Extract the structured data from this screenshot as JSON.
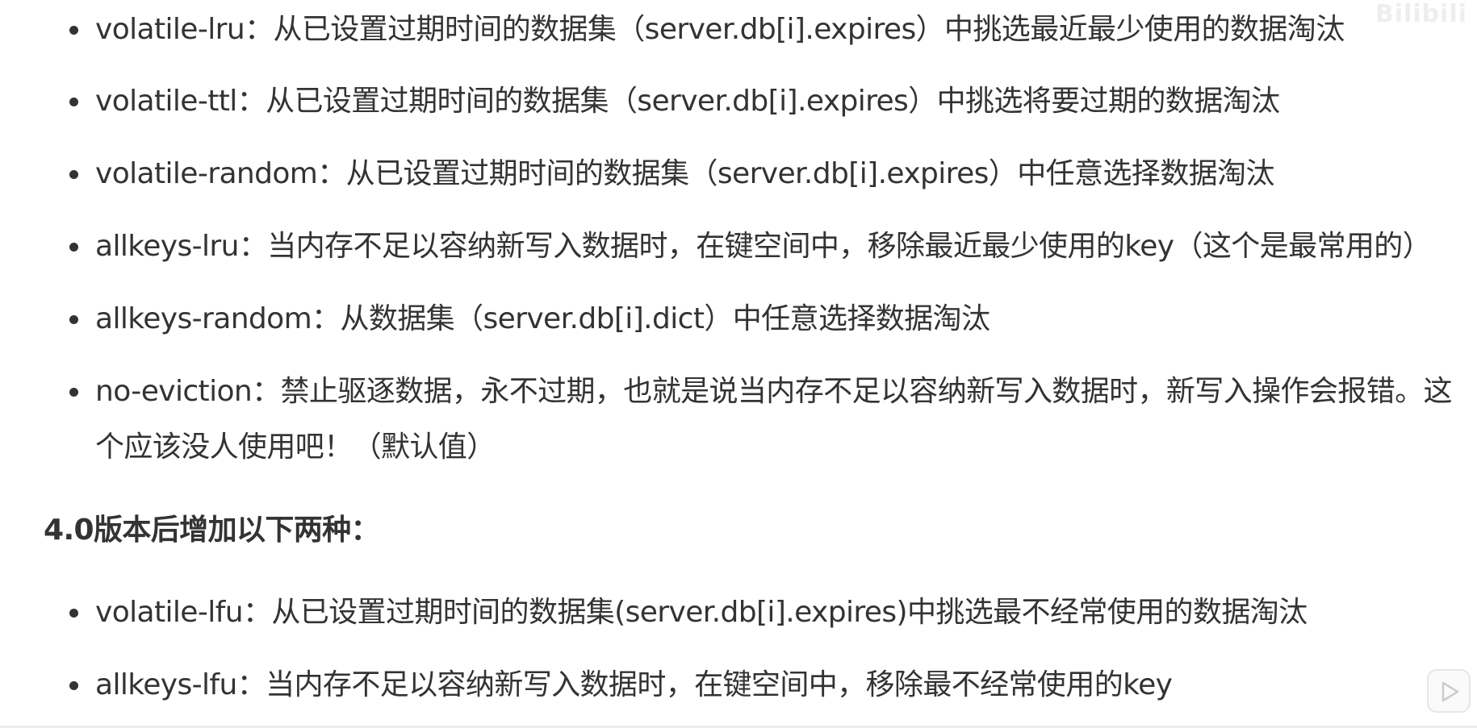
{
  "watermark": "Bilibili",
  "policies_main": [
    {
      "name": "volatile-lru",
      "text": "volatile-lru：从已设置过期时间的数据集（server.db[i].expires）中挑选最近最少使用的数据淘汰"
    },
    {
      "name": "volatile-ttl",
      "text": "volatile-ttl：从已设置过期时间的数据集（server.db[i].expires）中挑选将要过期的数据淘汰"
    },
    {
      "name": "volatile-random",
      "text": "volatile-random：从已设置过期时间的数据集（server.db[i].expires）中任意选择数据淘汰"
    },
    {
      "name": "allkeys-lru",
      "text": "allkeys-lru：当内存不足以容纳新写入数据时，在键空间中，移除最近最少使用的key（这个是最常用的）"
    },
    {
      "name": "allkeys-random",
      "text": "allkeys-random：从数据集（server.db[i].dict）中任意选择数据淘汰"
    },
    {
      "name": "no-eviction",
      "text": "no-eviction：禁止驱逐数据，永不过期，也就是说当内存不足以容纳新写入数据时，新写入操作会报错。这",
      "continuation": "个应该没人使用吧！（默认值）"
    }
  ],
  "section_heading": "4.0版本后增加以下两种：",
  "policies_v4": [
    {
      "name": "volatile-lfu",
      "text": "volatile-lfu：从已设置过期时间的数据集(server.db[i].expires)中挑选最不经常使用的数据淘汰"
    },
    {
      "name": "allkeys-lfu",
      "text": "allkeys-lfu：当内存不足以容纳新写入数据时，在键空间中，移除最不经常使用的key"
    }
  ],
  "icons": {
    "bullet": "bullet-dot-icon",
    "play": "play-icon"
  }
}
